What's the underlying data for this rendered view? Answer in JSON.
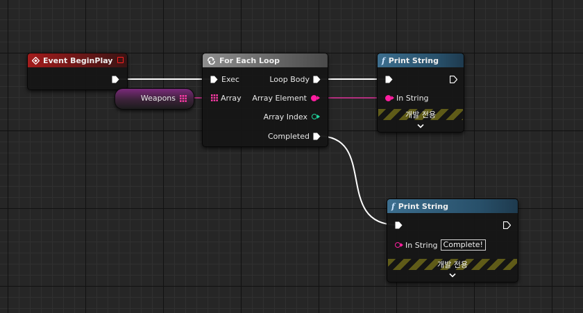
{
  "nodes": {
    "begin_play": {
      "title": "Event BeginPlay"
    },
    "weapons_var": {
      "label": "Weapons"
    },
    "for_each": {
      "title": "For Each Loop",
      "exec_label": "Exec",
      "array_label": "Array",
      "loop_body_label": "Loop Body",
      "array_element_label": "Array Element",
      "array_index_label": "Array Index",
      "completed_label": "Completed"
    },
    "print_string_1": {
      "title": "Print String",
      "in_string_label": "In String",
      "dev_only_label": "개발 전용"
    },
    "print_string_2": {
      "title": "Print String",
      "in_string_label": "In String",
      "in_string_value": "Complete!",
      "dev_only_label": "개발 전용"
    }
  },
  "colors": {
    "exec_wire": "#ffffff",
    "string_wire": "#e0309a",
    "string_pin": "#ff1ea0",
    "array_pin": "#ff3ca8",
    "int_pin": "#1fd8a0",
    "event_accent": "#ff2020"
  },
  "icons": {
    "event": "diamond-event-icon",
    "loop": "loop-macro-icon",
    "function": "function-f-icon"
  }
}
